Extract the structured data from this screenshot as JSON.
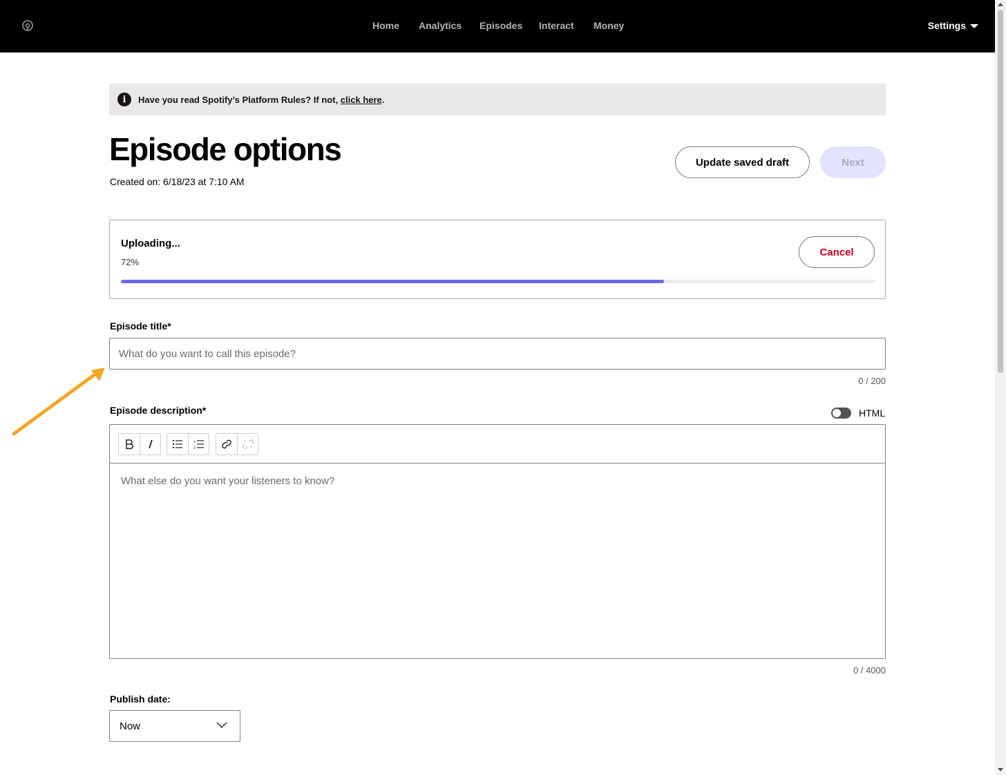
{
  "nav": {
    "items": [
      {
        "label": "Home"
      },
      {
        "label": "Analytics"
      },
      {
        "label": "Episodes"
      },
      {
        "label": "Interact"
      },
      {
        "label": "Money"
      }
    ],
    "settings_label": "Settings",
    "logo_icon": "podcast-mic-icon"
  },
  "banner": {
    "text": "Have you read Spotify’s Platform Rules? If not, ",
    "link": "click here",
    "suffix": "."
  },
  "header": {
    "title": "Episode options",
    "created": "Created on: 6/18/23 at 7:10 AM",
    "draft_button": "Update saved draft",
    "next_button": "Next"
  },
  "upload": {
    "status": "Uploading...",
    "percent_label": "72%",
    "progress": 0.72,
    "cancel_button": "Cancel",
    "accent_color": "#6a6af4"
  },
  "title_field": {
    "label": "Episode title*",
    "placeholder": "What do you want to call this episode?",
    "value": "",
    "counter": "0  /  200"
  },
  "description_field": {
    "label": "Episode description*",
    "html_toggle_label": "HTML",
    "toolbar": [
      "bold-icon",
      "italic-icon",
      "bullet-list-icon",
      "numbered-list-icon",
      "link-icon",
      "unlink-icon"
    ],
    "placeholder": "What else do you want your listeners to know?",
    "counter": "0  /  4000"
  },
  "publish": {
    "label": "Publish date:",
    "selected": "Now"
  },
  "colors": {
    "cancel": "#d1001f",
    "annotation_arrow": "#f5a623",
    "next_disabled_bg": "#e3e3fd"
  }
}
